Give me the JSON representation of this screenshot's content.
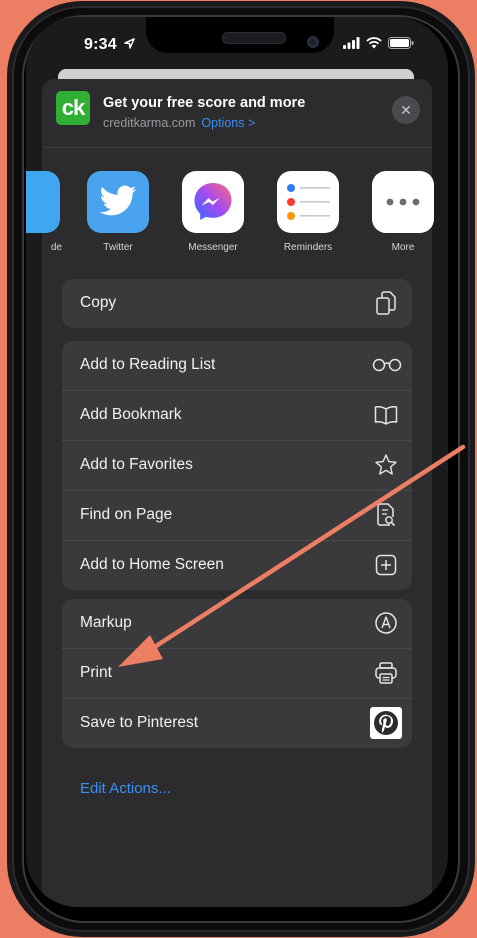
{
  "status": {
    "time": "9:34"
  },
  "header": {
    "logo_text": "ck",
    "title": "Get your free score and more",
    "domain": "creditkarma.com",
    "options_label": "Options >",
    "close_glyph": "✕"
  },
  "apps": [
    {
      "label": "de"
    },
    {
      "label": "Twitter"
    },
    {
      "label": "Messenger"
    },
    {
      "label": "Reminders"
    },
    {
      "label": "More"
    }
  ],
  "actions": {
    "group1": [
      {
        "label": "Copy",
        "icon": "copy-icon"
      }
    ],
    "group2": [
      {
        "label": "Add to Reading List",
        "icon": "glasses-icon"
      },
      {
        "label": "Add Bookmark",
        "icon": "book-icon"
      },
      {
        "label": "Add to Favorites",
        "icon": "star-icon"
      },
      {
        "label": "Find on Page",
        "icon": "find-doc-icon"
      },
      {
        "label": "Add to Home Screen",
        "icon": "add-square-icon"
      }
    ],
    "group3": [
      {
        "label": "Markup",
        "icon": "markup-icon"
      },
      {
        "label": "Print",
        "icon": "printer-icon"
      },
      {
        "label": "Save to Pinterest",
        "icon": "pinterest-icon"
      }
    ]
  },
  "edit_actions_label": "Edit Actions...",
  "colors": {
    "background": "#EC7E63",
    "accent": "#3A8EF6",
    "arrow": "#EC7E63",
    "sheet": "#2C2C2E",
    "row": "#3A3A3C"
  }
}
